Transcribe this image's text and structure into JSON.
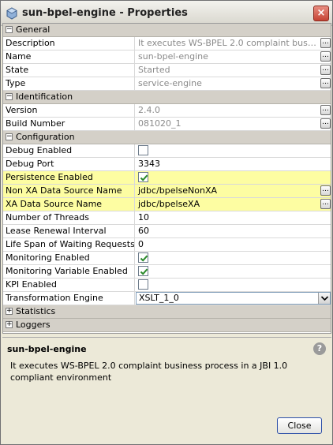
{
  "window": {
    "title": "sun-bpel-engine - Properties",
    "close_glyph": "×"
  },
  "sheet": {
    "general": {
      "label": "General",
      "rows": {
        "description": {
          "label": "Description",
          "value": "It executes WS-BPEL 2.0 complaint business process in a JBI 1.0 compliant environment"
        },
        "name": {
          "label": "Name",
          "value": "sun-bpel-engine"
        },
        "state": {
          "label": "State",
          "value": "Started"
        },
        "type": {
          "label": "Type",
          "value": "service-engine"
        }
      }
    },
    "identification": {
      "label": "Identification",
      "rows": {
        "version": {
          "label": "Version",
          "value": "2.4.0"
        },
        "build_number": {
          "label": "Build Number",
          "value": "081020_1"
        }
      }
    },
    "configuration": {
      "label": "Configuration",
      "rows": {
        "debug_enabled": {
          "label": "Debug Enabled",
          "checked": false
        },
        "debug_port": {
          "label": "Debug Port",
          "value": "3343"
        },
        "persistence_enabled": {
          "label": "Persistence Enabled",
          "checked": true
        },
        "non_xa_ds": {
          "label": "Non XA Data Source Name",
          "value": "jdbc/bpelseNonXA"
        },
        "xa_ds": {
          "label": "XA Data Source Name",
          "value": "jdbc/bpelseXA"
        },
        "threads": {
          "label": "Number of Threads",
          "value": "10"
        },
        "lease_renewal": {
          "label": "Lease Renewal Interval",
          "value": "60"
        },
        "life_span": {
          "label": "Life Span of Waiting Requests",
          "value": "0"
        },
        "monitoring_enabled": {
          "label": "Monitoring Enabled",
          "checked": true
        },
        "monitoring_variable": {
          "label": "Monitoring Variable Enabled",
          "checked": true
        },
        "kpi_enabled": {
          "label": "KPI Enabled",
          "checked": false
        },
        "transformation_engine": {
          "label": "Transformation Engine",
          "value": "XSLT_1_0"
        }
      }
    },
    "statistics": {
      "label": "Statistics"
    },
    "loggers": {
      "label": "Loggers"
    },
    "ellipsis": "..."
  },
  "description_panel": {
    "title": "sun-bpel-engine",
    "text": "It executes WS-BPEL 2.0 complaint business process in a JBI 1.0 compliant environment",
    "help_glyph": "?",
    "close_label": "Close"
  },
  "colors": {
    "highlight": "#fdfda2",
    "category": "#d4d0c8",
    "check": "#2a8a2a"
  }
}
